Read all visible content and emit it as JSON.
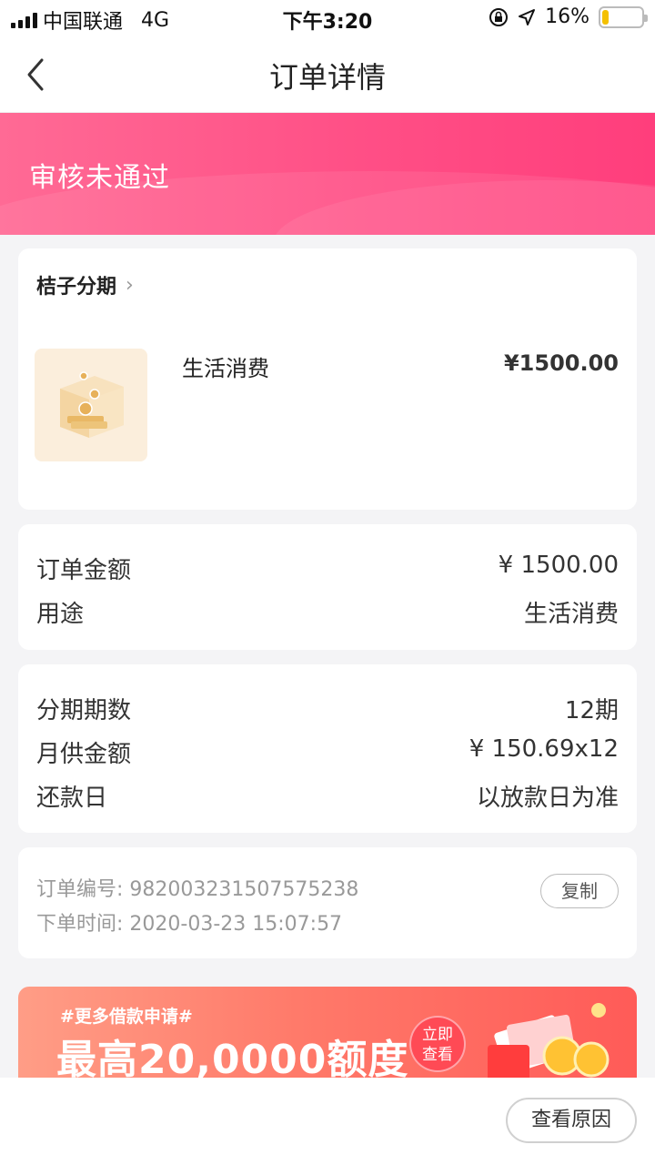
{
  "status_bar": {
    "carrier": "中国联通",
    "network": "4G",
    "time": "下午3:20",
    "battery_percent": "16%",
    "battery_level": 0.16,
    "icons": [
      "lock-rotation-icon",
      "location-arrow-icon",
      "battery-icon"
    ]
  },
  "nav": {
    "title": "订单详情",
    "back_icon": "chevron-left-icon"
  },
  "banner": {
    "status": "审核未通过",
    "color_start": "#ff6a95",
    "color_end": "#ff3e7c"
  },
  "merchant": {
    "name": "桔子分期",
    "chevron": "›"
  },
  "product": {
    "name": "生活消费",
    "price": "¥1500.00",
    "thumbnail_icon": "coin-box-icon"
  },
  "order_summary": {
    "rows": [
      {
        "label": "订单金额",
        "value": "¥ 1500.00"
      },
      {
        "label": "用途",
        "value": "生活消费"
      }
    ]
  },
  "installment": {
    "rows": [
      {
        "label": "分期期数",
        "value": "12期"
      },
      {
        "label": "月供金额",
        "value": "¥ 150.69x12"
      },
      {
        "label": "还款日",
        "value": "以放款日为准"
      }
    ]
  },
  "order_meta": {
    "order_no": "订单编号: 982003231507575238",
    "order_time": "下单时间: 2020-03-23 15:07:57",
    "copy_label": "复制"
  },
  "promo": {
    "tag": "#更多借款申请#",
    "headline": "最高20,0000额度",
    "cta_line1": "立即",
    "cta_line2": "查看"
  },
  "bottom": {
    "reason_label": "查看原因"
  }
}
